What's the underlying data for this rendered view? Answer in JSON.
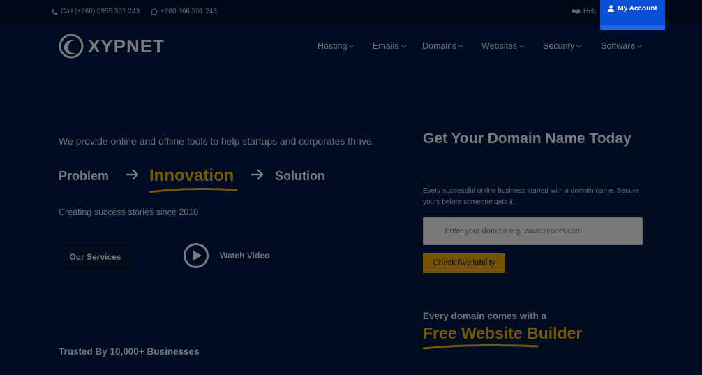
{
  "topbar": {
    "phone": "Call (+260) 0955 501 243",
    "whatsapp": "+260 966 501 243",
    "help": "Help",
    "account": "My Account"
  },
  "brand": {
    "name": "XYPNET"
  },
  "nav": {
    "items": [
      "Hosting",
      "Emails",
      "Domains",
      "Websites",
      "Security",
      "Software"
    ]
  },
  "hero": {
    "tagline": "We provide online and offline tools to help startups and corporates thrive.",
    "flow": [
      "Problem",
      "Innovation",
      "Solution"
    ],
    "since": "Creating success stories since 2010",
    "services_button": "Our Services",
    "watch_video": "Watch Video",
    "trusted": "Trusted By 10,000+ Businesses"
  },
  "domain": {
    "title": "Get Your Domain Name Today",
    "subtitle": "Every successful online business started with a domain name. Secure yours before someone gets it.",
    "placeholder": "Enter your domain e.g. www.xypnet.com",
    "button": "Check Availability",
    "every": "Every domain comes with a",
    "free": "Free Website Builder"
  },
  "colors": {
    "background": "#001a4a",
    "accent": "#f6b800",
    "account": "#0b4fd6"
  }
}
